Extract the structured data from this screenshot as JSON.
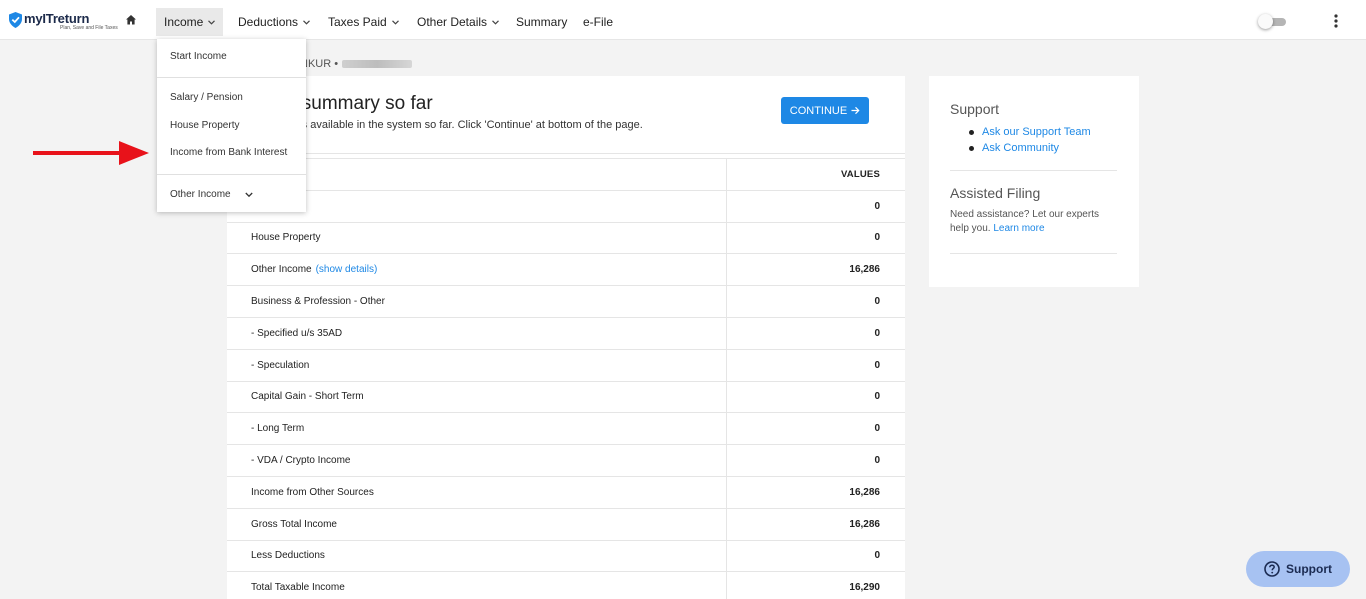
{
  "brand": {
    "name": "myITreturn",
    "tagline": "Plan, Save and File Taxes"
  },
  "nav": {
    "items": [
      {
        "label": "Income",
        "active": true,
        "has_caret": true
      },
      {
        "label": "Deductions",
        "has_caret": true
      },
      {
        "label": "Taxes Paid",
        "has_caret": true
      },
      {
        "label": "Other Details",
        "has_caret": true
      },
      {
        "label": "Summary",
        "has_caret": false
      },
      {
        "label": "e-File",
        "has_caret": false
      }
    ]
  },
  "dropdown": {
    "start_income": "Start Income",
    "salary": "Salary / Pension",
    "house_property": "House Property",
    "bank_interest": "Income from Bank Interest",
    "other_income": "Other Income"
  },
  "breadcrumb": {
    "text": "NKUR •"
  },
  "card": {
    "title": "x summary so far",
    "subtitle": "ta is available in the system so far. Click 'Continue' at bottom of the page.",
    "continue_label": "CONTINUE",
    "values_header": "VALUES",
    "rows": [
      {
        "label": "",
        "value": "0"
      },
      {
        "label": "House Property",
        "value": "0"
      },
      {
        "label": "Other Income",
        "link": "(show details)",
        "value": "16,286"
      },
      {
        "label": "Business & Profession - Other",
        "value": "0"
      },
      {
        "label": "- Specified u/s 35AD",
        "value": "0"
      },
      {
        "label": "- Speculation",
        "value": "0"
      },
      {
        "label": "Capital Gain - Short Term",
        "value": "0"
      },
      {
        "label": "- Long Term",
        "value": "0"
      },
      {
        "label": "- VDA / Crypto Income",
        "value": "0"
      },
      {
        "label": "Income from Other Sources",
        "value": "16,286"
      },
      {
        "label": "Gross Total Income",
        "value": "16,286"
      },
      {
        "label": "Less Deductions",
        "value": "0"
      },
      {
        "label": "Total Taxable Income",
        "value": "16,290"
      }
    ]
  },
  "sidebar": {
    "support_title": "Support",
    "links": [
      "Ask our Support Team",
      "Ask Community"
    ],
    "assisted_title": "Assisted Filing",
    "assisted_text": "Need assistance? Let our experts help you.",
    "learn_more": "Learn more"
  },
  "support_button": {
    "label": "Support"
  },
  "colors": {
    "accent": "#1e88e5",
    "arrow": "#e8121a",
    "support_bg": "#a7c2f2"
  }
}
